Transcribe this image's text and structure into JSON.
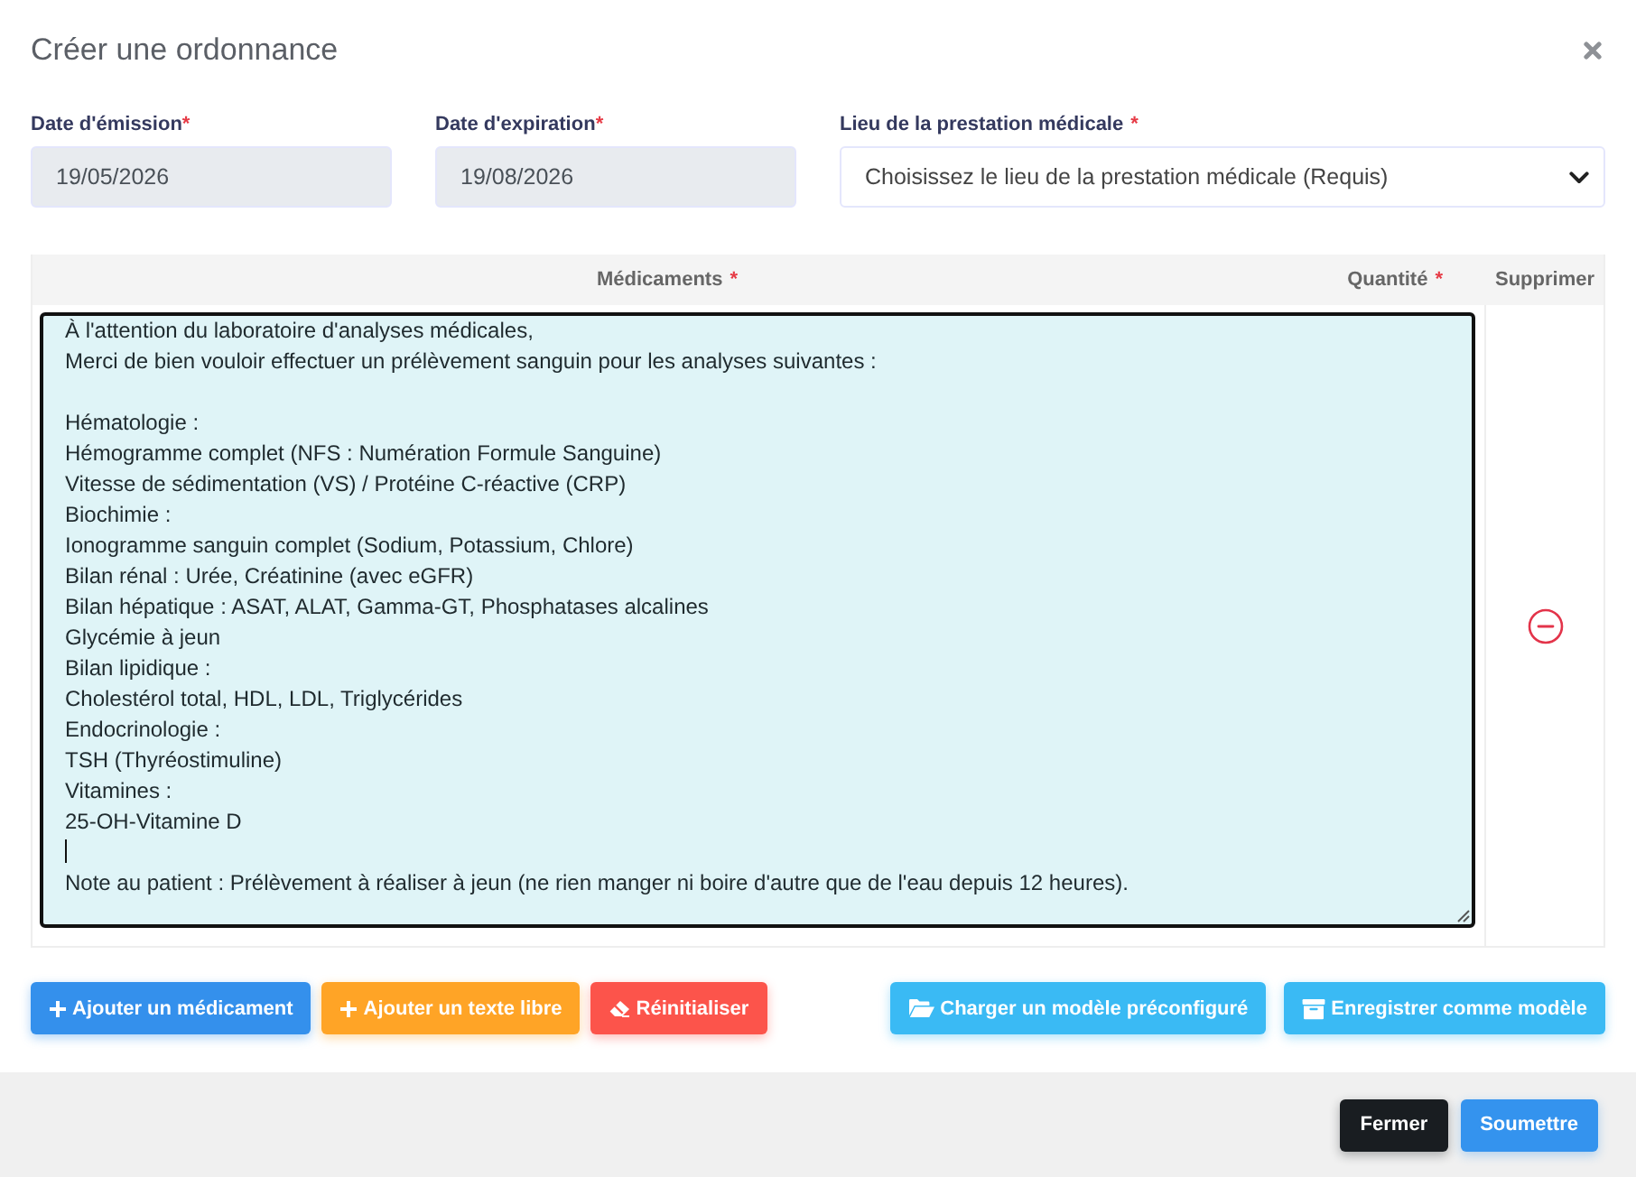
{
  "dialog": {
    "title": "Créer une ordonnance"
  },
  "fields": [
    {
      "kind": "date",
      "label": "Date d'émission",
      "required_mark": "*",
      "value": "19/05/2026",
      "disabled": true
    },
    {
      "kind": "date",
      "label": "Date d'expiration",
      "required_mark": "*",
      "value": "19/08/2026",
      "disabled": true
    },
    {
      "kind": "select",
      "label": "Lieu de la prestation médicale",
      "required_mark": "*",
      "value": "Choisissez le lieu de la prestation médicale (Requis)",
      "disabled": false
    }
  ],
  "table": {
    "columns": [
      {
        "label": "Médicaments",
        "required_mark": "*"
      },
      {
        "label": "Quantité",
        "required_mark": "*"
      },
      {
        "label": "Supprimer"
      }
    ],
    "rows": [
      {
        "kind": "free_text",
        "focused": true,
        "text_before_cursor": "À l'attention du laboratoire d'analyses médicales,\nMerci de bien vouloir effectuer un prélèvement sanguin pour les analyses suivantes :\n\nHématologie :\nHémogramme complet (NFS : Numération Formule Sanguine)\nVitesse de sédimentation (VS) / Protéine C-réactive (CRP)\nBiochimie :\nIonogramme sanguin complet (Sodium, Potassium, Chlore)\nBilan rénal : Urée, Créatinine (avec eGFR)\nBilan hépatique : ASAT, ALAT, Gamma-GT, Phosphatases alcalines\nGlycémie à jeun\nBilan lipidique :\nCholestérol total, HDL, LDL, Triglycérides\nEndocrinologie :\nTSH (Thyréostimuline)\nVitamines :\n25-OH-Vitamine D\n",
        "text_after_cursor": "\nNote au patient : Prélèvement à réaliser à jeun (ne rien manger ni boire d'autre que de l'eau depuis 12 heures)."
      }
    ]
  },
  "actions_left": [
    {
      "kind": "add",
      "label": "Ajouter un médicament",
      "color": "#3490ec"
    },
    {
      "kind": "add",
      "label": "Ajouter un texte libre",
      "color": "#ffa426"
    },
    {
      "kind": "reset",
      "label": "Réinitialiser",
      "color": "#fc544b"
    }
  ],
  "actions_right": [
    {
      "kind": "load",
      "label": "Charger un modèle préconfiguré",
      "color": "#3abaf4"
    },
    {
      "kind": "save",
      "label": "Enregistrer comme modèle",
      "color": "#3abaf4"
    }
  ],
  "footer_buttons": [
    {
      "label": "Fermer",
      "color": "#191d21"
    },
    {
      "label": "Soumettre",
      "color": "#3493ee"
    }
  ]
}
